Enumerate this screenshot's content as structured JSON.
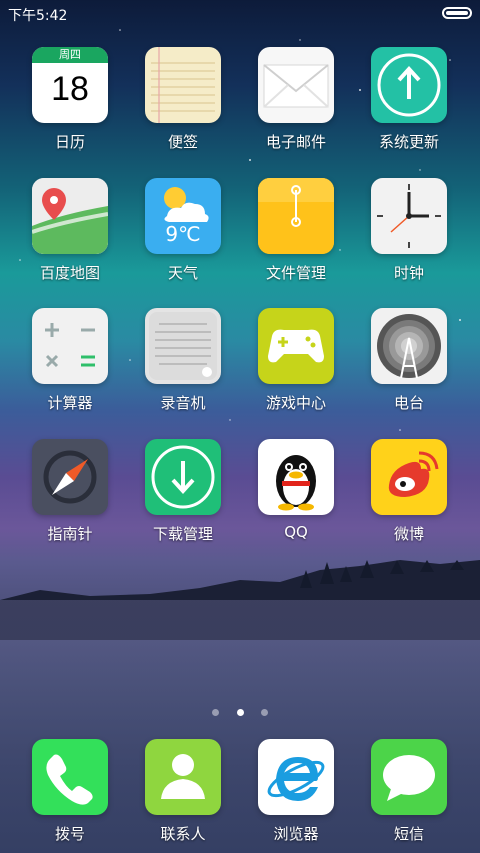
{
  "status_bar": {
    "time": "下午5:42",
    "battery_icon": "battery-icon"
  },
  "apps_row1": [
    {
      "label": "日历",
      "icon": "calendar-icon"
    },
    {
      "label": "便签",
      "icon": "notes-icon"
    },
    {
      "label": "电子邮件",
      "icon": "email-icon"
    },
    {
      "label": "系统更新",
      "icon": "system-update-icon"
    }
  ],
  "apps_row2": [
    {
      "label": "百度地图",
      "icon": "map-icon"
    },
    {
      "label": "天气",
      "icon": "weather-icon"
    },
    {
      "label": "文件管理",
      "icon": "folder-icon"
    },
    {
      "label": "时钟",
      "icon": "clock-icon"
    }
  ],
  "apps_row3": [
    {
      "label": "计算器",
      "icon": "calculator-icon"
    },
    {
      "label": "录音机",
      "icon": "recorder-icon"
    },
    {
      "label": "游戏中心",
      "icon": "gamepad-icon"
    },
    {
      "label": "电台",
      "icon": "radio-icon"
    }
  ],
  "apps_row4": [
    {
      "label": "指南针",
      "icon": "compass-icon"
    },
    {
      "label": "下载管理",
      "icon": "download-icon"
    },
    {
      "label": "QQ",
      "icon": "qq-penguin-icon"
    },
    {
      "label": "微博",
      "icon": "weibo-icon"
    }
  ],
  "calendar": {
    "weekday": "周四",
    "day": "18"
  },
  "weather": {
    "temperature": "9℃"
  },
  "page_indicator": {
    "pages": 3,
    "active_index": 1
  },
  "dock": [
    {
      "label": "拨号",
      "icon": "phone-icon"
    },
    {
      "label": "联系人",
      "icon": "contacts-icon"
    },
    {
      "label": "浏览器",
      "icon": "browser-icon"
    },
    {
      "label": "短信",
      "icon": "sms-icon"
    }
  ],
  "colors": {
    "calendar_green": "#1aa660",
    "update_teal": "#23c1a5",
    "weather_blue": "#3aaef0",
    "folder_yellow": "#ffc21a",
    "game_yellow_green": "#c6d41a",
    "download_green": "#1fbf78",
    "phone_green": "#33e05a",
    "contacts_green": "#8fd63f",
    "sms_green": "#4cd449",
    "weibo_yellow": "#ffd21a"
  }
}
